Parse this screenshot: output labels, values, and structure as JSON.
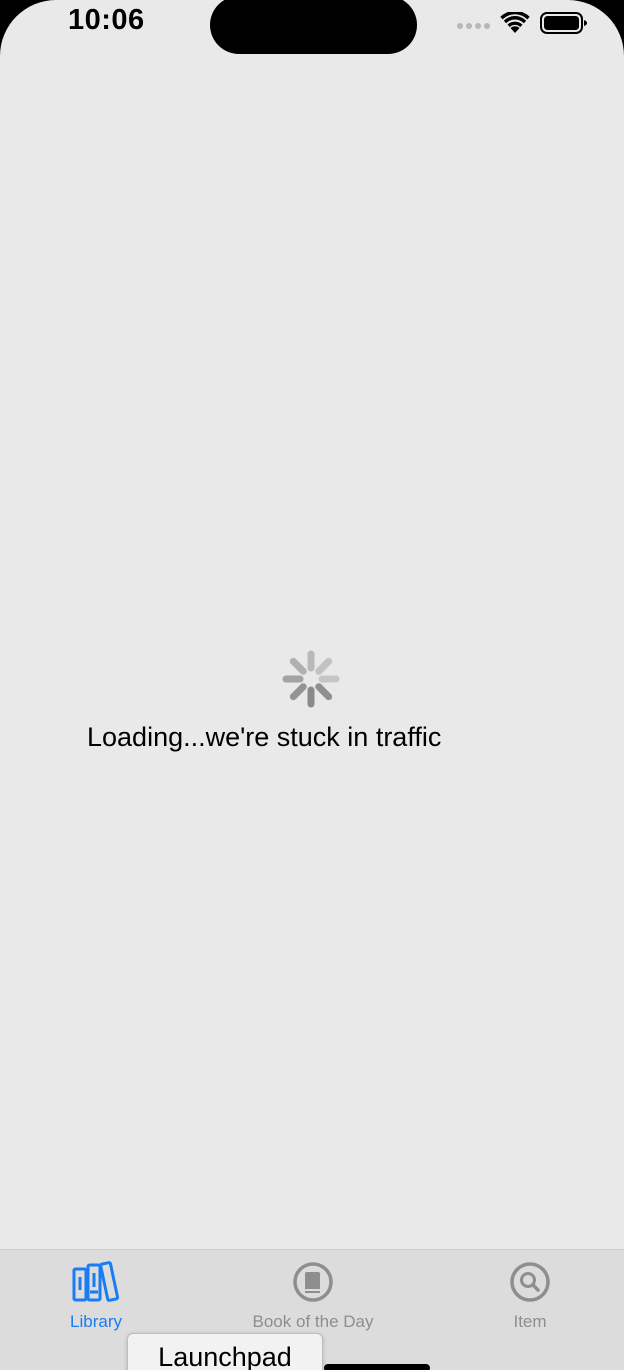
{
  "status_bar": {
    "time": "10:06"
  },
  "loading": {
    "text": "Loading...we're stuck in traffic"
  },
  "tabs": [
    {
      "label": "Library",
      "icon": "books-icon",
      "selected": true
    },
    {
      "label": "Book of the Day",
      "icon": "book-circle-icon",
      "selected": false
    },
    {
      "label": "Item",
      "icon": "magnifier-circle-icon",
      "selected": false
    }
  ],
  "tooltip": {
    "label": "Launchpad"
  },
  "colors": {
    "background": "#e9e9e9",
    "tab_bar": "#dcdcdc",
    "accent": "#1a7cf5",
    "inactive": "#8e8e8e",
    "spinner": "#8a8a8a"
  }
}
